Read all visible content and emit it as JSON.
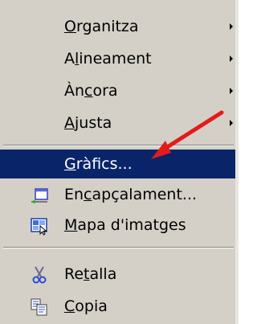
{
  "menu": {
    "items": [
      {
        "pre": "",
        "accel": "O",
        "post": "rganitza",
        "submenu": true,
        "icon": ""
      },
      {
        "pre": "A",
        "accel": "l",
        "post": "ineament",
        "submenu": true,
        "icon": ""
      },
      {
        "pre": "Àn",
        "accel": "c",
        "post": "ora",
        "submenu": true,
        "icon": ""
      },
      {
        "pre": "",
        "accel": "A",
        "post": "justa",
        "submenu": true,
        "icon": ""
      },
      {
        "pre": "",
        "accel": "G",
        "post": "ràfics...",
        "submenu": false,
        "selected": true,
        "icon": ""
      },
      {
        "pre": "En",
        "accel": "c",
        "post": "apçalament...",
        "submenu": false,
        "icon": "header-window-icon"
      },
      {
        "pre": "",
        "accel": "M",
        "post": "apa d'imatges",
        "submenu": false,
        "icon": "image-map-icon"
      },
      {
        "pre": "Re",
        "accel": "t",
        "post": "alla",
        "submenu": false,
        "icon": "scissors-icon"
      },
      {
        "pre": "",
        "accel": "C",
        "post": "opia",
        "submenu": false,
        "icon": "copy-icon"
      }
    ]
  },
  "colors": {
    "menu_bg": "#d4d0c8",
    "selection_bg": "#0a246a",
    "annotation_arrow": "#e31b1b"
  }
}
